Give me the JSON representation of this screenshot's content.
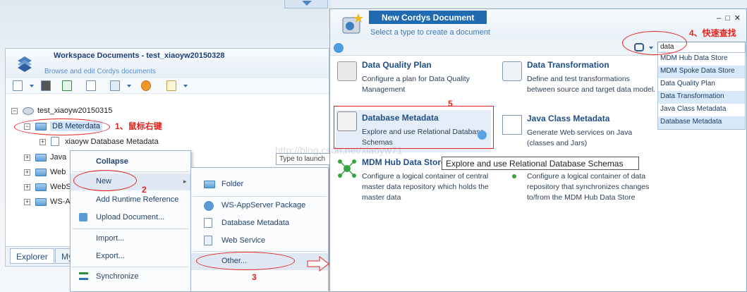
{
  "workspace": {
    "title": "Workspace Documents - test_xiaoyw20150328",
    "subtitle": "Browse and edit Cordys documents",
    "tree": {
      "root": "test_xiaoyw20150315",
      "selected": "DB Meterdata",
      "child": "xiaoyw Database Metadata",
      "folders": [
        "Java",
        "Web",
        "WebS",
        "WS-A"
      ]
    },
    "tabs": [
      "Explorer",
      "My"
    ]
  },
  "context_menu": {
    "items": [
      "Collapse",
      "New",
      "Add Runtime Reference",
      "Upload Document...",
      "Import...",
      "Export...",
      "Synchronize"
    ]
  },
  "submenu": {
    "items": [
      "Folder",
      "WS-AppServer Package",
      "Database Metadata",
      "Web Service",
      "Other..."
    ]
  },
  "launch_placeholder": "Type to launch",
  "new_document": {
    "title": "New Cordys Document",
    "subtitle": "Select a type to create a document",
    "search_value": "data",
    "suggestions": [
      "MDM Hub Data Store",
      "MDM Spoke Data Store",
      "Data Quality Plan",
      "Data Transformation",
      "Java Class Metadata",
      "Database Metadata"
    ],
    "types": [
      {
        "title": "Data Quality Plan",
        "desc": "Configure a plan for Data Quality Management"
      },
      {
        "title": "Data Transformation",
        "desc": "Define and test transformations between source and target data model."
      },
      {
        "title": "Database Metadata",
        "desc": "Explore and use Relational Database Schemas"
      },
      {
        "title": "Java Class Metadata",
        "desc": "Generate Web services on Java (classes and Jars)"
      },
      {
        "title": "MDM Hub Data Store",
        "desc": "Configure a logical container of central master data repository which holds the master data"
      },
      {
        "title": "",
        "desc": "Configure a logical container of data repository that synchronizes changes to/from the MDM Hub Data Store"
      }
    ],
    "tooltip": "Explore and use Relational Database Schemas"
  },
  "watermark": "http://blog.csdn.net/xiaoyw71",
  "annotations": {
    "a1": "1、鼠标右键",
    "a2": "2",
    "a3": "3",
    "a4": "4、快速查找",
    "a5": "5"
  },
  "colors": {
    "accent": "#1f6ab0",
    "annotation": "#e3241f"
  }
}
